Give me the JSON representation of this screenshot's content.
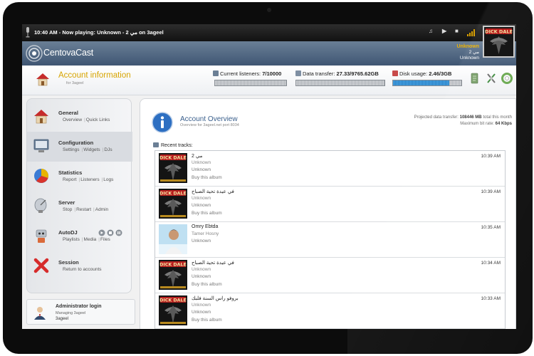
{
  "player": {
    "now_playing": "10:40 AM - Now playing: Unknown - 2 مي on 3ageel",
    "controls": [
      "♫",
      "▶",
      "■"
    ]
  },
  "header": {
    "brand": "CentovaCast",
    "now_playing_artist": "Unknown",
    "now_playing_title": "مي 2",
    "now_playing_album": "Unknown"
  },
  "account": {
    "title": "Account information",
    "subtitle": "for 3ageel"
  },
  "stats": {
    "listeners_label": "Current listeners:",
    "listeners_value": "7/10000",
    "listeners_fraction": 0.0007,
    "transfer_label": "Data transfer:",
    "transfer_value": "27.33/9765.62GB",
    "transfer_fraction": 0.003,
    "disk_label": "Disk usage:",
    "disk_value": "2.46/3GB",
    "disk_fraction": 0.82
  },
  "nav": [
    {
      "title": "General",
      "links": [
        "Overview",
        "Quick Links"
      ],
      "icon": "house-icon"
    },
    {
      "title": "Configuration",
      "links": [
        "Settings",
        "Widgets",
        "DJs"
      ],
      "icon": "monitor-icon"
    },
    {
      "title": "Statistics",
      "links": [
        "Report",
        "Listeners",
        "Logs"
      ],
      "icon": "pie-chart-icon"
    },
    {
      "title": "Server",
      "links": [
        "Stop",
        "Restart",
        "Admin"
      ],
      "icon": "satellite-dish-icon"
    },
    {
      "title": "AutoDJ",
      "links": [
        "Playlists",
        "Media",
        "Files"
      ],
      "icon": "robot-icon"
    },
    {
      "title": "Session",
      "links": [
        "Return to accounts"
      ],
      "icon": "red-x-icon"
    }
  ],
  "admin": {
    "title": "Administrator login",
    "line2": "Managing 3ageel",
    "line3": "3ageel"
  },
  "overview": {
    "title": "Account Overview",
    "subtitle": "Overview for 3ageel.net port 8034",
    "projected_label": "Projected data transfer:",
    "projected_value": "108446 MB",
    "projected_suffix": "total this month",
    "bitrate_label": "Maximum bit rate:",
    "bitrate_value": "64 Kbps"
  },
  "recent": {
    "label": "Recent tracks:",
    "tracks": [
      {
        "title": "مي 2",
        "artist": "Unknown",
        "album": "Unknown",
        "buy": "Buy this album",
        "time": "10:39 AM",
        "cover": "dick-dale"
      },
      {
        "title": "في عيدة تحية الصباح",
        "artist": "Unknown",
        "album": "Unknown",
        "buy": "Buy this album",
        "time": "10:39 AM",
        "cover": "dick-dale"
      },
      {
        "title": "Omry Ebtda",
        "artist": "Tamer Hosny",
        "album": "Unknown",
        "buy": "",
        "time": "10:35 AM",
        "cover": "portrait"
      },
      {
        "title": "في عيدة تحية الصباح",
        "artist": "Unknown",
        "album": "Unknown",
        "buy": "Buy this album",
        "time": "10:34 AM",
        "cover": "dick-dale"
      },
      {
        "title": "بروفو راس السنة فلبك",
        "artist": "Unknown",
        "album": "Unknown",
        "buy": "Buy this album",
        "time": "10:33 AM",
        "cover": "dick-dale"
      }
    ]
  }
}
